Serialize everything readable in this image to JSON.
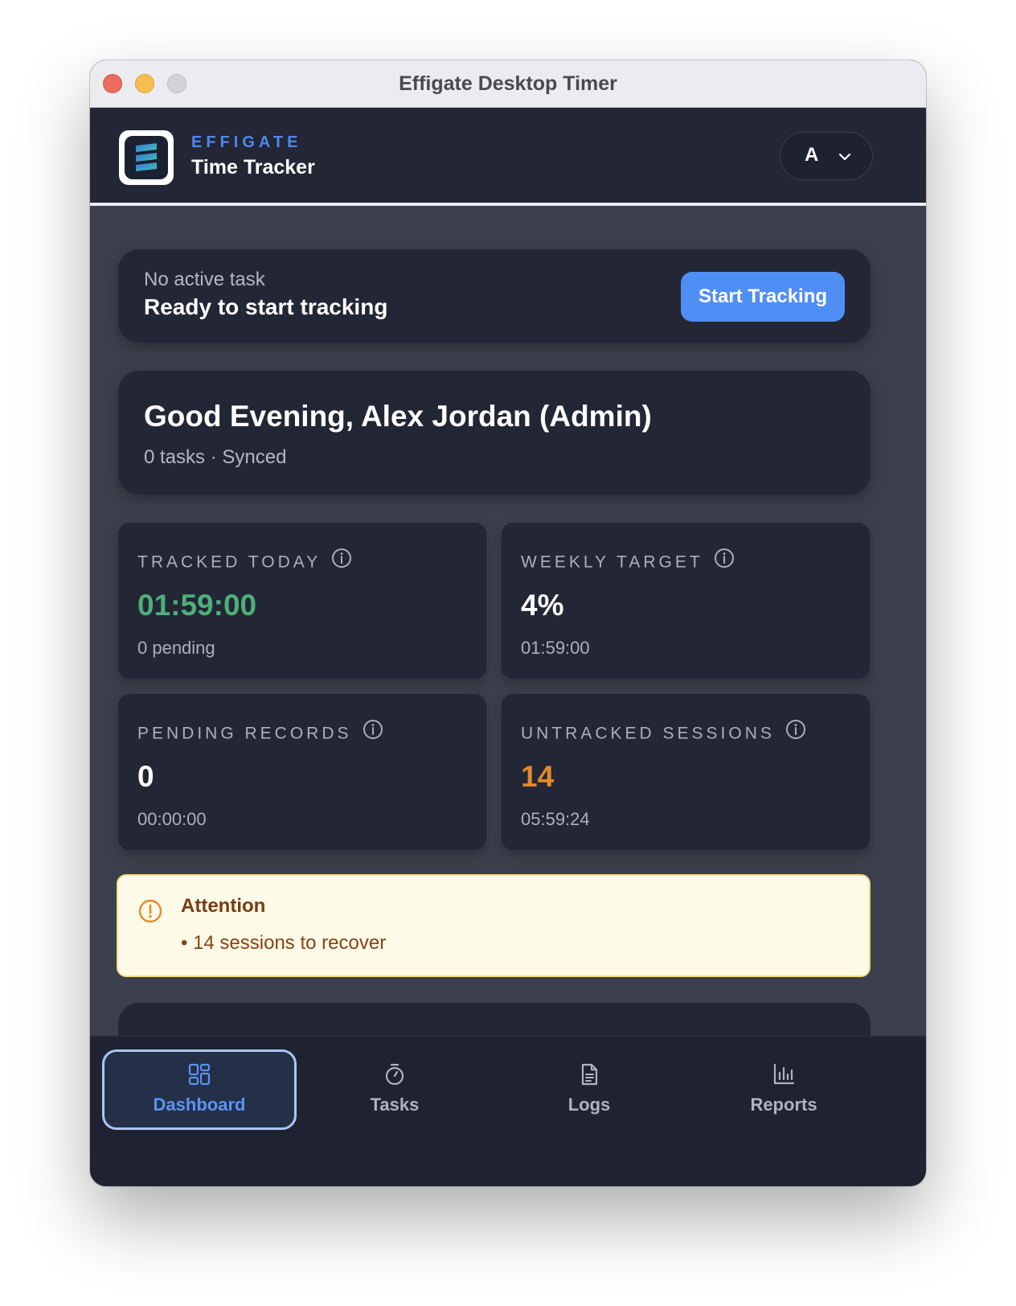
{
  "window": {
    "title": "Effigate Desktop Timer"
  },
  "header": {
    "brand": "EFFIGATE",
    "subtitle": "Time Tracker",
    "account_initial": "A"
  },
  "tracking": {
    "label": "No active task",
    "status": "Ready to start tracking",
    "button_label": "Start Tracking"
  },
  "greeting": {
    "title": "Good Evening, Alex Jordan (Admin)",
    "subtitle": "0 tasks · Synced"
  },
  "stats": [
    {
      "label": "TRACKED TODAY",
      "value": "01:59:00",
      "sub": "0 pending",
      "value_color": "#4caf7a"
    },
    {
      "label": "WEEKLY TARGET",
      "value": "4%",
      "sub": "01:59:00",
      "value_color": "#ffffff"
    },
    {
      "label": "PENDING RECORDS",
      "value": "0",
      "sub": "00:00:00",
      "value_color": "#ffffff"
    },
    {
      "label": "UNTRACKED SESSIONS",
      "value": "14",
      "sub": "05:59:24",
      "value_color": "#e08a2e"
    }
  ],
  "alert": {
    "title": "Attention",
    "items": [
      "• 14 sessions to recover"
    ]
  },
  "nav": [
    {
      "label": "Dashboard",
      "icon": "grid-icon",
      "active": true
    },
    {
      "label": "Tasks",
      "icon": "stopwatch-icon",
      "active": false
    },
    {
      "label": "Logs",
      "icon": "document-icon",
      "active": false
    },
    {
      "label": "Reports",
      "icon": "bar-chart-icon",
      "active": false
    }
  ],
  "colors": {
    "accent": "#4f8ef5",
    "background": "#3b3f4b",
    "card": "#232634",
    "success": "#4caf7a",
    "warning": "#e08a2e",
    "alert_bg": "#fefae8",
    "alert_border": "#f3dc82"
  }
}
